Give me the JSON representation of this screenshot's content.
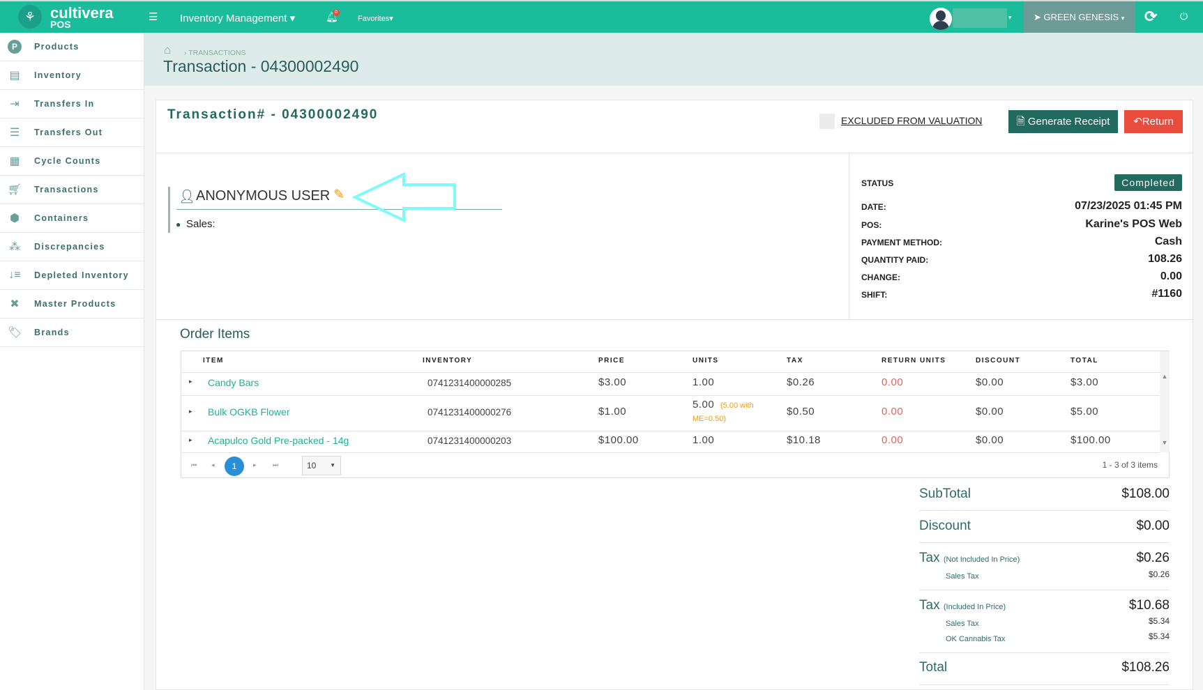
{
  "header": {
    "brand": "cultivera",
    "brand_sub": "POS",
    "module": "Inventory Management",
    "notification_count": "0",
    "favorites": "Favorites",
    "location": "GREEN GENESIS"
  },
  "sidebar": {
    "items": [
      {
        "label": "Products",
        "icon": "p-circle-icon"
      },
      {
        "label": "Inventory",
        "icon": "server-icon"
      },
      {
        "label": "Transfers In",
        "icon": "indent-icon"
      },
      {
        "label": "Transfers Out",
        "icon": "outdent-icon"
      },
      {
        "label": "Cycle Counts",
        "icon": "calculator-icon"
      },
      {
        "label": "Transactions",
        "icon": "cart-icon"
      },
      {
        "label": "Containers",
        "icon": "cube-icon"
      },
      {
        "label": "Discrepancies",
        "icon": "cubes-icon"
      },
      {
        "label": "Depleted Inventory",
        "icon": "sort-down-icon"
      },
      {
        "label": "Master Products",
        "icon": "pinwheel-icon"
      },
      {
        "label": "Brands",
        "icon": "tag-icon"
      }
    ]
  },
  "breadcrumb": {
    "current": "TRANSACTIONS"
  },
  "page_title": "Transaction - 04300002490",
  "card": {
    "title": "Transaction# - 04300002490",
    "excluded_label": "EXCLUDED FROM VALUATION",
    "generate_receipt": "Generate Receipt",
    "return": "Return"
  },
  "customer": {
    "name": "ANONYMOUS USER",
    "sales_label": "Sales:"
  },
  "details": {
    "status_label": "STATUS",
    "status": "Completed",
    "rows": [
      {
        "label": "DATE:",
        "value": "07/23/2025 01:45 PM"
      },
      {
        "label": "POS:",
        "value": "Karine's POS Web"
      },
      {
        "label": "PAYMENT METHOD:",
        "value": "Cash"
      },
      {
        "label": "QUANTITY PAID:",
        "value": "108.26"
      },
      {
        "label": "CHANGE:",
        "value": "0.00"
      },
      {
        "label": "SHIFT:",
        "value": "#1160"
      }
    ]
  },
  "order": {
    "title": "Order Items",
    "columns": [
      "ITEM",
      "INVENTORY",
      "PRICE",
      "UNITS",
      "TAX",
      "RETURN UNITS",
      "DISCOUNT",
      "TOTAL"
    ],
    "rows": [
      {
        "item": "Candy Bars",
        "inventory": "0741231400000285",
        "price": "$3.00",
        "units": "1.00",
        "units_note": "",
        "tax": "$0.26",
        "return_units": "0.00",
        "discount": "$0.00",
        "total": "$3.00"
      },
      {
        "item": "Bulk OGKB Flower",
        "inventory": "0741231400000276",
        "price": "$1.00",
        "units": "5.00",
        "units_note": "(5.00 with",
        "units_note2": "ME=0.50)",
        "tax": "$0.50",
        "return_units": "0.00",
        "discount": "$0.00",
        "total": "$5.00"
      },
      {
        "item": "Acapulco Gold Pre-packed - 14g",
        "inventory": "0741231400000203",
        "price": "$100.00",
        "units": "1.00",
        "units_note": "",
        "tax": "$10.18",
        "return_units": "0.00",
        "discount": "$0.00",
        "total": "$100.00"
      }
    ],
    "page": "1",
    "page_size": "10",
    "count": "1 - 3 of 3 items"
  },
  "summary": {
    "subtotal_label": "SubTotal",
    "subtotal": "$108.00",
    "discount_label": "Discount",
    "discount": "$0.00",
    "tax1_label": "Tax",
    "tax1_note": "(Not Included In Price)",
    "tax1": "$0.26",
    "tax1_sub_label": "Sales Tax",
    "tax1_sub": "$0.26",
    "tax2_label": "Tax",
    "tax2_note": "(Included In Price)",
    "tax2": "$10.68",
    "tax2_sub1_label": "Sales Tax",
    "tax2_sub1": "$5.34",
    "tax2_sub2_label": "OK Cannabis Tax",
    "tax2_sub2": "$5.34",
    "total_label": "Total",
    "total": "$108.26"
  },
  "colors": {
    "header": "#1bbc9b",
    "dark_teal": "#22695f",
    "return": "#e74c3c",
    "link": "#1bb394",
    "orange": "#f39c12",
    "annotation": "#7ff9fb"
  }
}
